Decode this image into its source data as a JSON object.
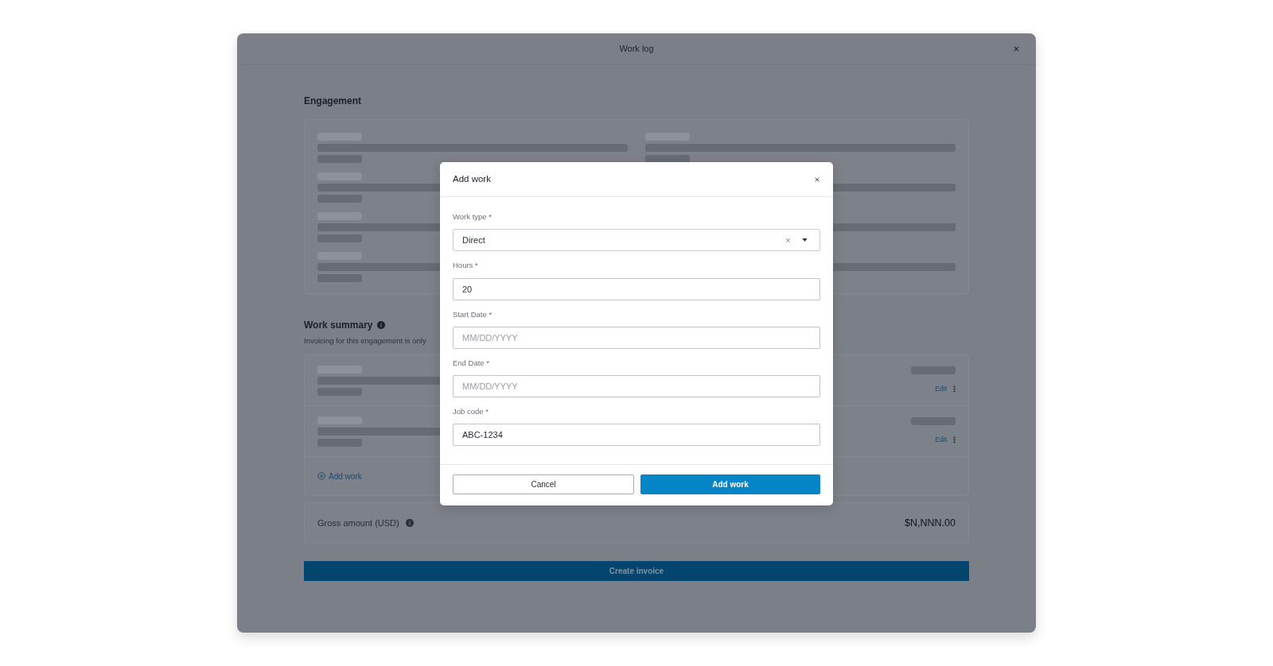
{
  "window": {
    "title": "Work log"
  },
  "engagement": {
    "heading": "Engagement"
  },
  "work_summary": {
    "heading": "Work summary",
    "note": "Invoicing for this engagement is only",
    "entries": [
      {
        "action": "Edit"
      },
      {
        "action": "Edit"
      }
    ],
    "add_link": "Add work"
  },
  "gross": {
    "label": "Gross amount (USD)",
    "amount": "$N,NNN.00"
  },
  "create_button": "Create invoice",
  "dialog": {
    "title": "Add work",
    "fields": [
      {
        "kind": "select",
        "label": "Work type *",
        "value": "Direct"
      },
      {
        "kind": "text",
        "label": "Hours *",
        "value": "20"
      },
      {
        "kind": "text",
        "label": "Start Date *",
        "placeholder": "MM/DD/YYYY"
      },
      {
        "kind": "text",
        "label": "End Date *",
        "placeholder": "MM/DD/YYYY"
      },
      {
        "kind": "text",
        "label": "Job code *",
        "value": "ABC-1234"
      }
    ],
    "cancel": "Cancel",
    "submit": "Add work"
  }
}
